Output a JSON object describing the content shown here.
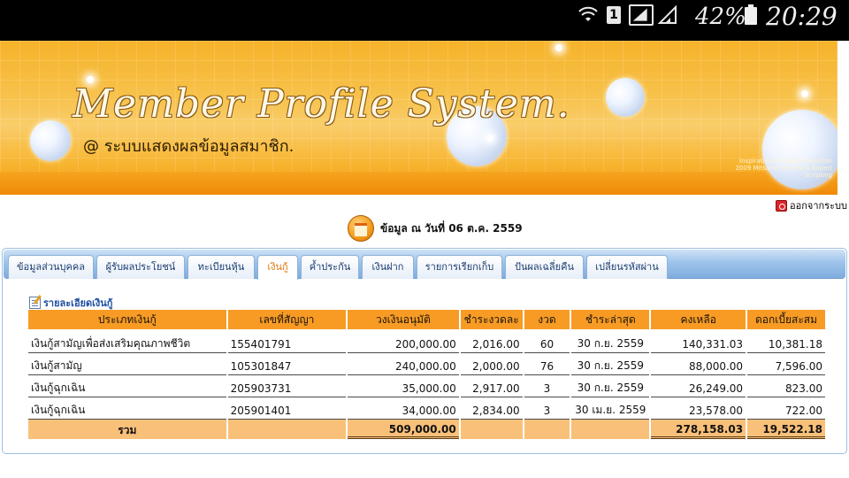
{
  "status_bar": {
    "sim_label": "1",
    "battery_percent": "42%",
    "time": "20:29"
  },
  "banner": {
    "title": "Member Profile System.",
    "subtitle": "@ ระบบแสดงผลข้อมูลสมาชิก.",
    "tagline_1": "Inspiration for Expert Solution",
    "tagline_2": "2009 Mitsaro Security & Expert Scripting"
  },
  "header": {
    "logout_label": "ออกจากระบบ",
    "date_label": "ข้อมูล ณ วันที่ 06 ต.ค. 2559"
  },
  "tabs": [
    {
      "label": "ข้อมูลส่วนบุคคล",
      "active": false
    },
    {
      "label": "ผู้รับผลประโยชน์",
      "active": false
    },
    {
      "label": "ทะเบียนหุ้น",
      "active": false
    },
    {
      "label": "เงินกู้",
      "active": true
    },
    {
      "label": "ค้ำประกัน",
      "active": false
    },
    {
      "label": "เงินฝาก",
      "active": false
    },
    {
      "label": "รายการเรียกเก็บ",
      "active": false
    },
    {
      "label": "ปันผลเฉลี่ยคืน",
      "active": false
    },
    {
      "label": "เปลี่ยนรหัสผ่าน",
      "active": false
    }
  ],
  "loans": {
    "section_title": "รายละเอียดเงินกู้",
    "columns": [
      "ประเภทเงินกู้",
      "เลขที่สัญญา",
      "วงเงินอนุมัติ",
      "ชำระงวดละ",
      "งวด",
      "ชำระล่าสุด",
      "คงเหลือ",
      "ดอกเบี้ยสะสม"
    ],
    "rows": [
      {
        "type": "เงินกู้สามัญเพื่อส่งเสริมคุณภาพชีวิต",
        "contract": "155401791",
        "approved": "200,000.00",
        "installment": "2,016.00",
        "period": "60",
        "last_paid": "30 ก.ย. 2559",
        "balance": "140,331.03",
        "interest": "10,381.18"
      },
      {
        "type": "เงินกู้สามัญ",
        "contract": "105301847",
        "approved": "240,000.00",
        "installment": "2,000.00",
        "period": "76",
        "last_paid": "30 ก.ย. 2559",
        "balance": "88,000.00",
        "interest": "7,596.00"
      },
      {
        "type": "เงินกู้ฉุกเฉิน",
        "contract": "205903731",
        "approved": "35,000.00",
        "installment": "2,917.00",
        "period": "3",
        "last_paid": "30 ก.ย. 2559",
        "balance": "26,249.00",
        "interest": "823.00"
      },
      {
        "type": "เงินกู้ฉุกเฉิน",
        "contract": "205901401",
        "approved": "34,000.00",
        "installment": "2,834.00",
        "period": "3",
        "last_paid": "30 เม.ย. 2559",
        "balance": "23,578.00",
        "interest": "722.00"
      }
    ],
    "total": {
      "label": "รวม",
      "approved": "509,000.00",
      "balance": "278,158.03",
      "interest": "19,522.18"
    }
  },
  "colors": {
    "header_orange": "#f79b25",
    "total_orange": "#f9c07a",
    "tab_blue": "#9dc3ea",
    "active_tab_text": "#e0780c"
  }
}
